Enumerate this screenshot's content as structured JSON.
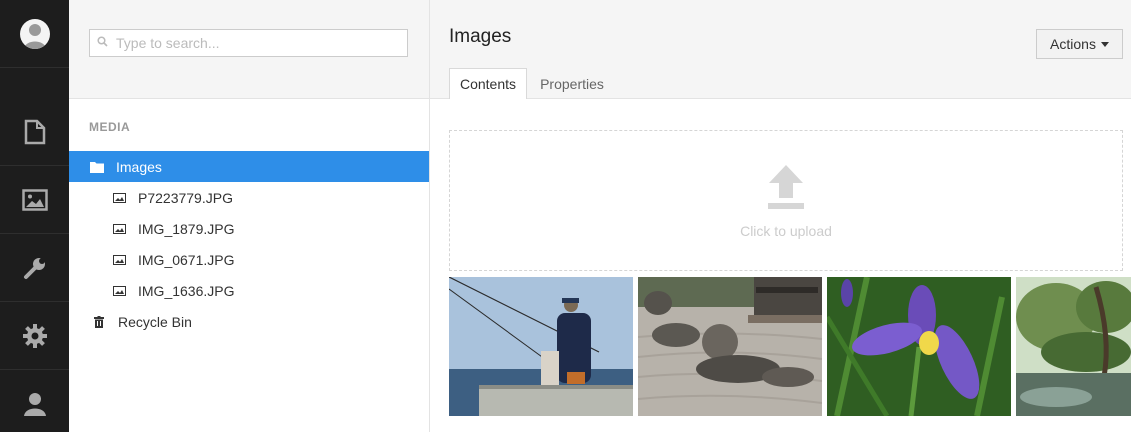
{
  "rail": {
    "items": [
      {
        "icon": "user-avatar-icon"
      },
      {
        "icon": "content-document-icon"
      },
      {
        "icon": "media-image-icon"
      },
      {
        "icon": "wrench-icon"
      },
      {
        "icon": "gear-icon"
      },
      {
        "icon": "user-icon"
      }
    ]
  },
  "tree": {
    "search_placeholder": "Type to search...",
    "section_label": "MEDIA",
    "nodes": [
      {
        "label": "Images",
        "icon": "folder-icon",
        "selected": true
      },
      {
        "label": "P7223779.JPG",
        "icon": "image-file-icon"
      },
      {
        "label": "IMG_1879.JPG",
        "icon": "image-file-icon"
      },
      {
        "label": "IMG_0671.JPG",
        "icon": "image-file-icon"
      },
      {
        "label": "IMG_1636.JPG",
        "icon": "image-file-icon"
      },
      {
        "label": "Recycle Bin",
        "icon": "trash-icon"
      }
    ]
  },
  "main": {
    "title": "Images",
    "actions_label": "Actions",
    "tabs": [
      {
        "label": "Contents",
        "active": true
      },
      {
        "label": "Properties",
        "active": false
      }
    ],
    "upload_label": "Click to upload"
  },
  "colors": {
    "accent": "#2e8ee8",
    "rail_bg": "#1d1d1d",
    "header_bg": "#f5f5f5"
  }
}
